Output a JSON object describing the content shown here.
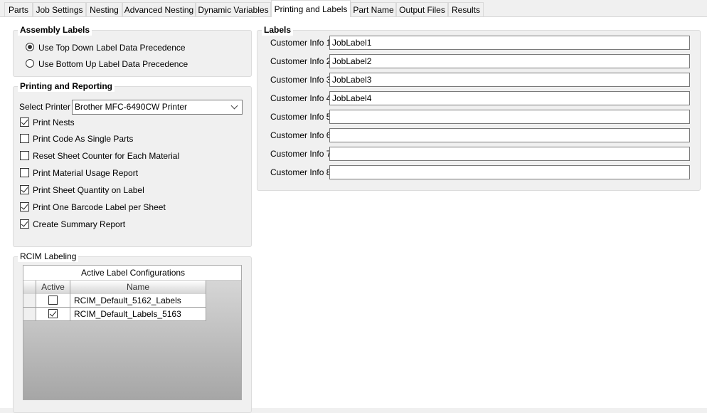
{
  "tabs": [
    {
      "label": "Parts"
    },
    {
      "label": "Job Settings"
    },
    {
      "label": "Nesting"
    },
    {
      "label": "Advanced Nesting"
    },
    {
      "label": "Dynamic Variables"
    },
    {
      "label": "Printing and Labels",
      "active": true
    },
    {
      "label": "Part Name"
    },
    {
      "label": "Output Files"
    },
    {
      "label": "Results"
    }
  ],
  "assembly_labels": {
    "title": "Assembly Labels",
    "options": [
      {
        "label": "Use Top Down Label Data Precedence",
        "selected": true
      },
      {
        "label": "Use Bottom Up Label Data Precedence",
        "selected": false
      }
    ]
  },
  "printing": {
    "title": "Printing and Reporting",
    "select_label": "Select Printer",
    "printer": "Brother MFC-6490CW Printer",
    "checks": [
      {
        "label": "Print Nests",
        "checked": true
      },
      {
        "label": "Print Code As Single Parts",
        "checked": false
      },
      {
        "label": "Reset Sheet Counter for Each Material",
        "checked": false
      },
      {
        "label": "Print Material Usage Report",
        "checked": false
      },
      {
        "label": "Print Sheet Quantity on Label",
        "checked": true
      },
      {
        "label": "Print One Barcode Label per Sheet",
        "checked": true
      },
      {
        "label": "Create Summary Report",
        "checked": true
      }
    ]
  },
  "rcim": {
    "title": "RCIM Labeling",
    "caption": "Active Label Configurations",
    "columns": [
      "Active",
      "Name"
    ],
    "rows": [
      {
        "active": false,
        "name": "RCIM_Default_5162_Labels"
      },
      {
        "active": true,
        "name": "RCIM_Default_Labels_5163"
      }
    ]
  },
  "labels": {
    "title": "Labels",
    "fields": [
      {
        "label": "Customer Info 1",
        "value": "JobLabel1"
      },
      {
        "label": "Customer Info 2",
        "value": "JobLabel2"
      },
      {
        "label": "Customer Info 3",
        "value": "JobLabel3"
      },
      {
        "label": "Customer Info 4",
        "value": "JobLabel4"
      },
      {
        "label": "Customer Info 5",
        "value": ""
      },
      {
        "label": "Customer Info 6",
        "value": ""
      },
      {
        "label": "Customer Info 7",
        "value": ""
      },
      {
        "label": "Customer Info 8",
        "value": ""
      }
    ]
  }
}
